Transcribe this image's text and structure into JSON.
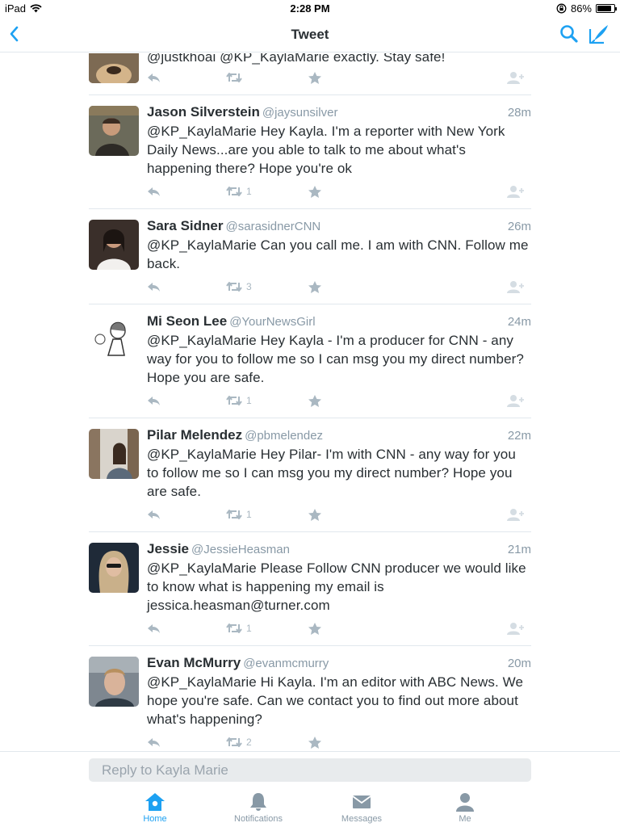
{
  "colors": {
    "accent": "#1da1f2",
    "icon_gray": "#aab8c2",
    "tab_gray": "#8899a6",
    "divider": "#e1e8ed"
  },
  "status_bar": {
    "device": "iPad",
    "time": "2:28 PM",
    "battery": "86%",
    "battery_level": 0.86
  },
  "nav": {
    "title": "Tweet",
    "back_icon": "chevron-left-icon",
    "search_icon": "search-icon",
    "compose_icon": "compose-icon"
  },
  "tweets": [
    {
      "name": "",
      "handle": "",
      "time": "",
      "text": "@justkhoai @KP_KaylaMarie exactly. Stay safe!",
      "retweets": ""
    },
    {
      "name": "Jason Silverstein",
      "handle": "@jaysunsilver",
      "time": "28m",
      "text": "@KP_KaylaMarie Hey Kayla. I'm a reporter with New York Daily News...are you able to talk to me about what's happening there? Hope you're ok",
      "retweets": "1"
    },
    {
      "name": "Sara Sidner",
      "handle": "@sarasidnerCNN",
      "time": "26m",
      "text": "@KP_KaylaMarie Can you call me. I am with CNN. Follow me back.",
      "retweets": "3"
    },
    {
      "name": "Mi Seon Lee",
      "handle": "@YourNewsGirl",
      "time": "24m",
      "text": "@KP_KaylaMarie Hey Kayla - I'm a producer for CNN - any way for you to follow me so I can msg you my direct number? Hope you are safe.",
      "retweets": "1"
    },
    {
      "name": "Pilar Melendez",
      "handle": "@pbmelendez",
      "time": "22m",
      "text": "@KP_KaylaMarie Hey Pilar- I'm with CNN - any way for you to follow me so I can msg you my direct number? Hope you are safe.",
      "retweets": "1"
    },
    {
      "name": "Jessie",
      "handle": "@JessieHeasman",
      "time": "21m",
      "text": "@KP_KaylaMarie Please Follow CNN producer we would like to know what is happening my email is jessica.heasman@turner.com",
      "retweets": "1"
    },
    {
      "name": "Evan McMurry",
      "handle": "@evanmcmurry",
      "time": "20m",
      "text": "@KP_KaylaMarie Hi Kayla. I'm an editor with ABC News. We hope you're safe. Can we contact you to find out more about what's happening?",
      "retweets": "2"
    }
  ],
  "reply": {
    "placeholder": "Reply to Kayla Marie"
  },
  "tabs": [
    {
      "label": "Home",
      "icon": "home-icon",
      "active": true
    },
    {
      "label": "Notifications",
      "icon": "bell-icon",
      "active": false
    },
    {
      "label": "Messages",
      "icon": "envelope-icon",
      "active": false
    },
    {
      "label": "Me",
      "icon": "person-icon",
      "active": false
    }
  ]
}
